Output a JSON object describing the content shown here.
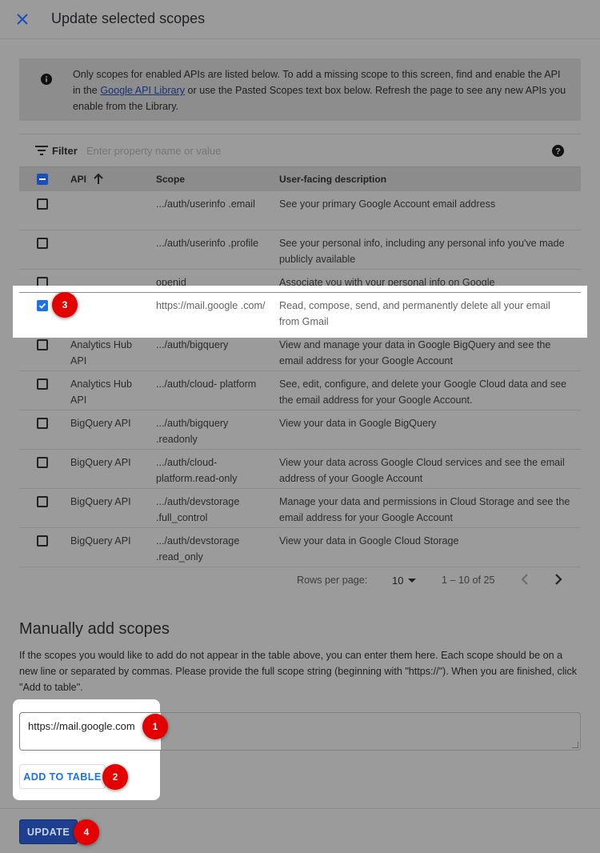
{
  "header": {
    "title": "Update selected scopes",
    "close_icon": "close-icon"
  },
  "info": {
    "text_before": "Only scopes for enabled APIs are listed below. To add a missing scope to this screen, find and enable the API in the ",
    "link_text": "Google API Library",
    "text_after": " or use the Pasted Scopes text box below. Refresh the page to see any new APIs you enable from the Library."
  },
  "filter": {
    "label": "Filter",
    "placeholder": "Enter property name or value"
  },
  "table": {
    "columns": {
      "api": "API",
      "scope": "Scope",
      "description": "User-facing description"
    },
    "rows": [
      {
        "api": "",
        "scope": ".../auth/userinfo .email",
        "description": "See your primary Google Account email address",
        "checked": false
      },
      {
        "api": "",
        "scope": ".../auth/userinfo .profile",
        "description": "See your personal info, including any personal info you've made publicly available",
        "checked": false
      },
      {
        "api": "",
        "scope": "openid",
        "description": "Associate you with your personal info on Google",
        "checked": false
      },
      {
        "api": "",
        "scope": "https://mail.google .com/",
        "description": "Read, compose, send, and permanently delete all your email from Gmail",
        "checked": true
      },
      {
        "api": "Analytics Hub API",
        "scope": ".../auth/bigquery",
        "description": "View and manage your data in Google BigQuery and see the email address for your Google Account",
        "checked": false
      },
      {
        "api": "Analytics Hub API",
        "scope": ".../auth/cloud- platform",
        "description": "See, edit, configure, and delete your Google Cloud data and see the email address for your Google Account.",
        "checked": false
      },
      {
        "api": "BigQuery API",
        "scope": ".../auth/bigquery .readonly",
        "description": "View your data in Google BigQuery",
        "checked": false
      },
      {
        "api": "BigQuery API",
        "scope": ".../auth/cloud- platform.read-only",
        "description": "View your data across Google Cloud services and see the email address of your Google Account",
        "checked": false
      },
      {
        "api": "BigQuery API",
        "scope": ".../auth/devstorage .full_control",
        "description": "Manage your data and permissions in Cloud Storage and see the email address for your Google Account",
        "checked": false
      },
      {
        "api": "BigQuery API",
        "scope": ".../auth/devstorage .read_only",
        "description": "View your data in Google Cloud Storage",
        "checked": false
      }
    ]
  },
  "pager": {
    "rows_per_page_label": "Rows per page:",
    "rows_per_page": "10",
    "range": "1 – 10 of 25"
  },
  "manual": {
    "title": "Manually add scopes",
    "description": "If the scopes you would like to add do not appear in the table above, you can enter them here. Each scope should be on a new line or separated by commas. Please provide the full scope string (beginning with \"https://\"). When you are finished, click \"Add to table\".",
    "textarea_value": "https://mail.google.com",
    "add_button": "ADD TO TABLE"
  },
  "footer": {
    "update_button": "UPDATE"
  },
  "badges": [
    "1",
    "2",
    "3",
    "4"
  ],
  "colors": {
    "accent": "#1a73e8",
    "update_button": "#1e3f8f",
    "badge": "#e50000"
  }
}
